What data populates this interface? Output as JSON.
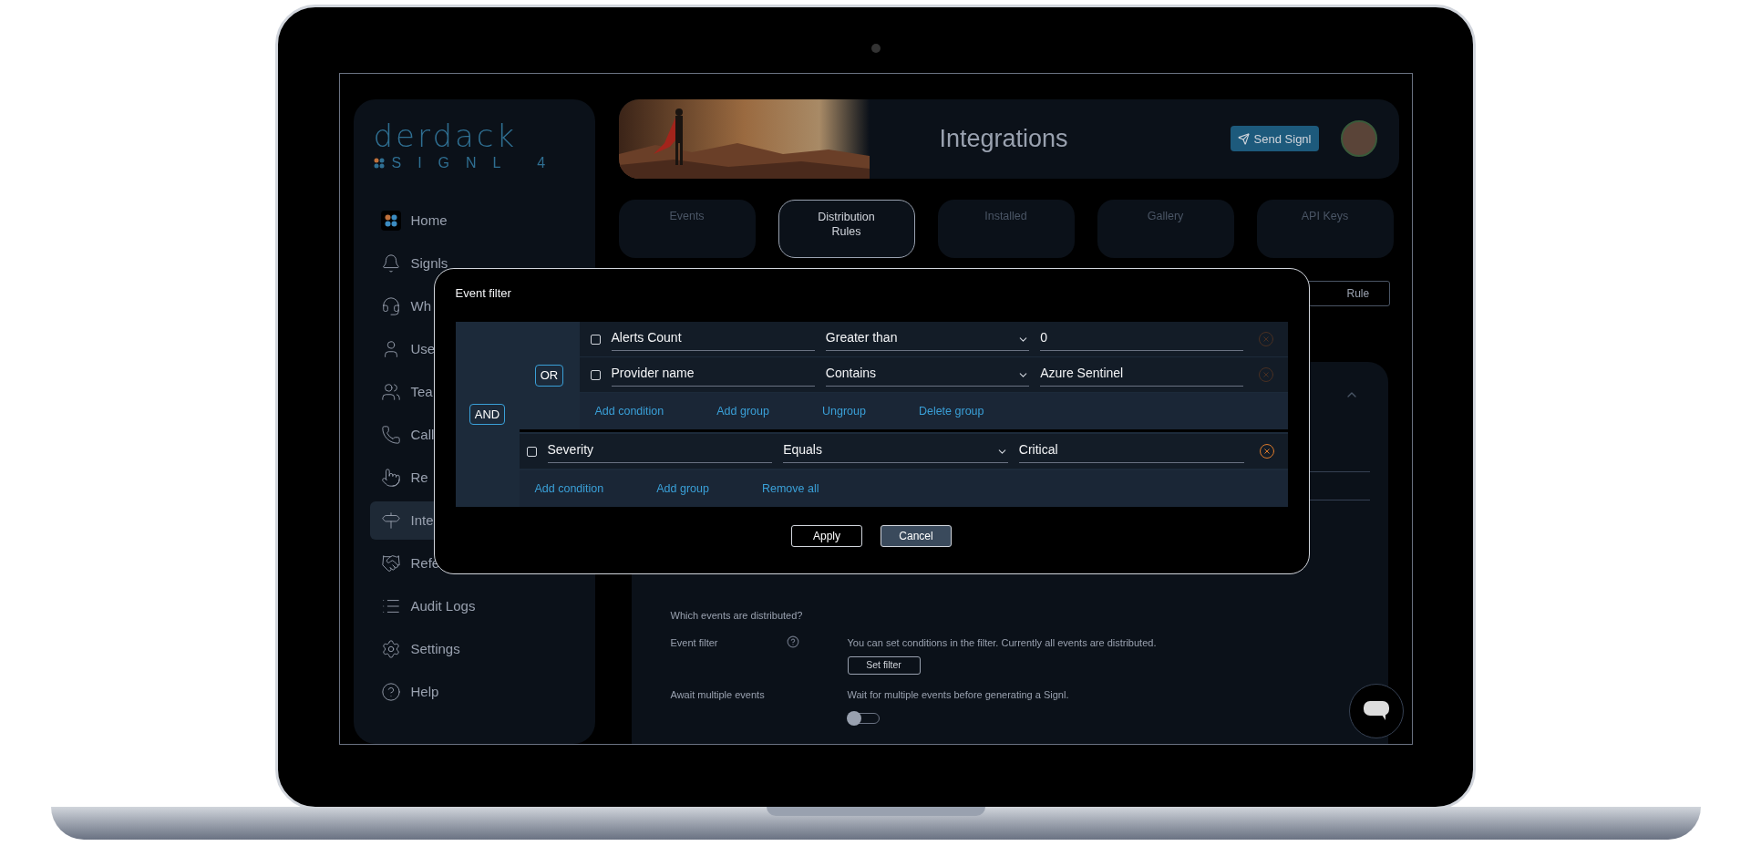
{
  "sidebar": {
    "logo": {
      "brand": "derdack",
      "product": "SIGNL 4"
    },
    "items": [
      {
        "kind": "home",
        "label": "Home",
        "selected": false
      },
      {
        "kind": "bell",
        "label": "Signls",
        "selected": false
      },
      {
        "kind": "headset",
        "label": "Wh",
        "selected": false
      },
      {
        "kind": "user",
        "label": "Use",
        "selected": false
      },
      {
        "kind": "users",
        "label": "Tea",
        "selected": false
      },
      {
        "kind": "phone",
        "label": "Call",
        "selected": false
      },
      {
        "kind": "pointer",
        "label": "Re",
        "selected": false
      },
      {
        "kind": "signpost",
        "label": "Inte",
        "selected": true
      },
      {
        "kind": "handshake",
        "label": "Refe",
        "selected": false
      },
      {
        "kind": "list",
        "label": "Audit Logs",
        "selected": false
      },
      {
        "kind": "settings",
        "label": "Settings",
        "selected": false
      },
      {
        "kind": "help",
        "label": "Help",
        "selected": false
      }
    ]
  },
  "header": {
    "title": "Integrations",
    "send_button": "Send Signl"
  },
  "tabs": [
    {
      "label": "Events",
      "selected": false
    },
    {
      "label": "Distribution Rules",
      "selected": true
    },
    {
      "label": "Installed",
      "selected": false
    },
    {
      "label": "Gallery",
      "selected": false
    },
    {
      "label": "API Keys",
      "selected": false
    }
  ],
  "rule_button": "Rule",
  "distribution": {
    "heading": "Which events are distributed?",
    "rows": [
      {
        "kind": "button",
        "label": "Event filter",
        "description": "You can set conditions in the filter. Currently all events are distributed.",
        "button": "Set filter"
      },
      {
        "kind": "toggle",
        "label": "Await multiple events",
        "description": "Wait for multiple events before generating a Signl.",
        "on": false
      }
    ]
  },
  "dialog": {
    "title": "Event filter",
    "operator": "AND",
    "group": {
      "operator": "OR",
      "conditions": [
        {
          "checked": false,
          "field": "Alerts Count",
          "operator": "Greater than",
          "value": "0",
          "removable": false
        },
        {
          "checked": false,
          "field": "Provider name",
          "operator": "Contains",
          "value": "Azure Sentinel",
          "removable": false
        }
      ],
      "actions": [
        "Add condition",
        "Add group",
        "Ungroup",
        "Delete group"
      ]
    },
    "conditions": [
      {
        "checked": false,
        "field": "Severity",
        "operator": "Equals",
        "value": "Critical",
        "removable": true
      }
    ],
    "actions": [
      "Add condition",
      "Add group",
      "Remove all"
    ],
    "buttons": [
      {
        "label": "Apply",
        "kind": "outline"
      },
      {
        "label": "Cancel",
        "kind": "filled"
      }
    ]
  }
}
